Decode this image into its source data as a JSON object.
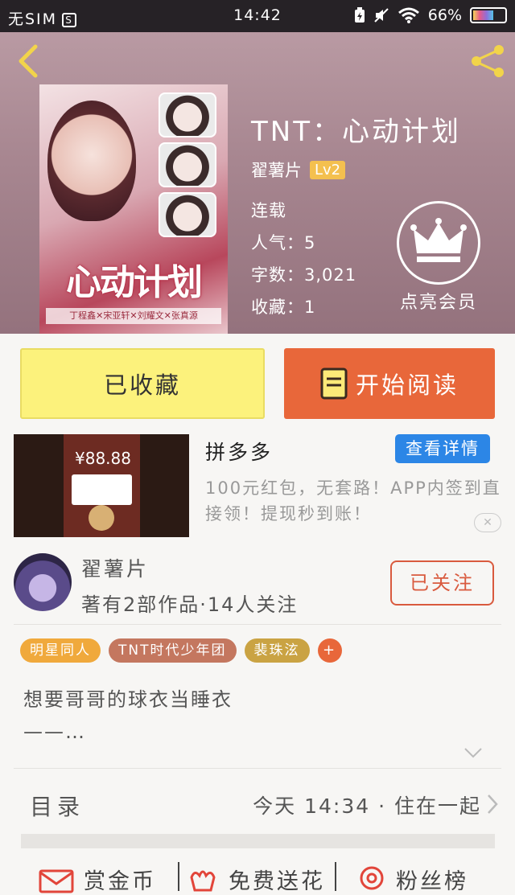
{
  "status_bar": {
    "carrier": "无SIM",
    "sim_icon": "S",
    "time": "14:42",
    "battery": "66%",
    "battery_level": 0.66
  },
  "header": {
    "back_icon": "chevron-left-icon",
    "share_icon": "share-icon",
    "cover": {
      "title_art": "心动计划",
      "tag_strip": "丁程鑫✕宋亚轩✕刘耀文✕张真源"
    },
    "book_title": "TNT：心动计划",
    "author": "翟薯片",
    "level": "Lv2",
    "status": "连载",
    "popularity": "人气：5",
    "word_count": "字数：3,021",
    "favorites": "收藏：1",
    "vip_label": "点亮会员",
    "vip_icon": "crown-icon"
  },
  "actions": {
    "collect_label": "已收藏",
    "read_label": "开始阅读",
    "read_icon": "book-icon"
  },
  "ad": {
    "image_amount": "¥88.88",
    "title": "拼多多",
    "button_label": "查看详情",
    "description": "100元红包，无套路！APP内签到直接领！提现秒到账！",
    "close_label": "✕"
  },
  "author_section": {
    "name": "翟薯片",
    "stats": "著有2部作品·14人关注",
    "follow_label": "已关注"
  },
  "tags": [
    {
      "label": "明星同人",
      "color": "#f0a93c"
    },
    {
      "label": "TNT时代少年团",
      "color": "#c4775f"
    },
    {
      "label": "裴珠泫",
      "color": "#caa343"
    }
  ],
  "tag_more": "+",
  "summary": {
    "line1": "想要哥哥的球衣当睡衣",
    "line2": "——…"
  },
  "toc": {
    "label": "目录",
    "latest": "今天 14:34 · 住在一起"
  },
  "bottom_bar": {
    "items": [
      {
        "label": "赏金币",
        "icon": "envelope-icon"
      },
      {
        "label": "免费送花",
        "icon": "flower-icon"
      },
      {
        "label": "粉丝榜",
        "icon": "location-pin-icon"
      }
    ]
  },
  "colors": {
    "accent_orange": "#e8673a",
    "collect_yellow": "#fcf27c",
    "ad_blue": "#2c86e6",
    "level_badge": "#f4c04f"
  }
}
